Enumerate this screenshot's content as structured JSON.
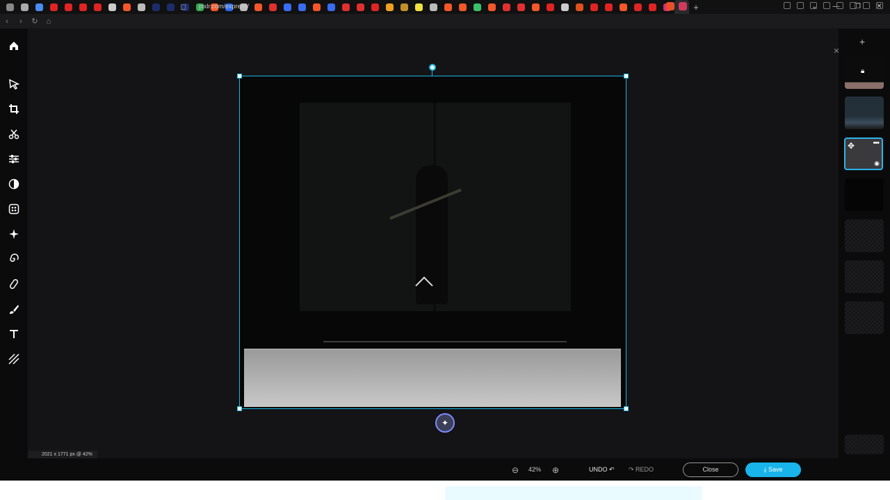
{
  "browser": {
    "tabs": [
      {
        "name": "chrome-icon",
        "color": "#888"
      },
      {
        "name": "settings-icon",
        "color": "#aaa"
      },
      {
        "name": "doc-icon",
        "color": "#4b8cf0"
      },
      {
        "name": "youtube-icon",
        "color": "#e02424"
      },
      {
        "name": "youtube-icon",
        "color": "#e02424"
      },
      {
        "name": "youtube-icon",
        "color": "#e02424"
      },
      {
        "name": "youtube-icon",
        "color": "#e02424"
      },
      {
        "name": "wordpress-icon",
        "color": "#ccc"
      },
      {
        "name": "brave-icon",
        "color": "#f4572a"
      },
      {
        "name": "search-icon",
        "color": "#bbb"
      },
      {
        "name": "us-icon",
        "color": "#1c2d6b"
      },
      {
        "name": "us-icon",
        "color": "#1c2d6b"
      },
      {
        "name": "us-icon",
        "color": "#1c2d6b"
      },
      {
        "name": "chrome-icon",
        "color": "#34a853"
      },
      {
        "name": "brave-icon",
        "color": "#f4572a"
      },
      {
        "name": "site-icon",
        "color": "#2c6df5"
      },
      {
        "name": "search-icon",
        "color": "#bbb"
      },
      {
        "name": "brave-icon",
        "color": "#f4572a"
      },
      {
        "name": "site-icon",
        "color": "#e03030"
      },
      {
        "name": "site-icon",
        "color": "#3a6cf4"
      },
      {
        "name": "site-icon",
        "color": "#3a6cf4"
      },
      {
        "name": "brave-icon",
        "color": "#f4572a"
      },
      {
        "name": "site-icon",
        "color": "#3a6cf4"
      },
      {
        "name": "minus-icon",
        "color": "#e03030"
      },
      {
        "name": "pen-icon",
        "color": "#e03030"
      },
      {
        "name": "youtube-icon",
        "color": "#e02424"
      },
      {
        "name": "site-icon",
        "color": "#f0a020"
      },
      {
        "name": "site-icon",
        "color": "#c0902a"
      },
      {
        "name": "note-icon",
        "color": "#f0e040"
      },
      {
        "name": "game-icon",
        "color": "#bbb"
      },
      {
        "name": "brave-icon",
        "color": "#f4572a"
      },
      {
        "name": "brave-icon",
        "color": "#f4572a"
      },
      {
        "name": "site-icon",
        "color": "#3cc06c"
      },
      {
        "name": "brave-icon",
        "color": "#f4572a"
      },
      {
        "name": "site-icon",
        "color": "#e03030"
      },
      {
        "name": "site-icon",
        "color": "#e03030"
      },
      {
        "name": "brave-icon",
        "color": "#f4572a"
      },
      {
        "name": "youtube-icon",
        "color": "#e02424"
      },
      {
        "name": "speaker-icon",
        "color": "#ccc"
      },
      {
        "name": "site-icon",
        "color": "#e0501c"
      },
      {
        "name": "youtube-icon",
        "color": "#e02424"
      },
      {
        "name": "youtube-icon",
        "color": "#e02424"
      },
      {
        "name": "brave-icon",
        "color": "#f4572a"
      },
      {
        "name": "youtube-icon",
        "color": "#e02424"
      },
      {
        "name": "youtube-icon",
        "color": "#e02424"
      },
      {
        "name": "instagram-icon",
        "color": "#d6306e"
      }
    ],
    "url": "pixlr.com/express/"
  },
  "editor": {
    "tools": [
      "home-icon",
      "arrange-tool-icon",
      "crop-tool-icon",
      "cutout-tool-icon",
      "adjust-tool-icon",
      "filter-tool-icon",
      "effect-tool-icon",
      "retouch-tool-icon",
      "liquify-tool-icon",
      "heal-tool-icon",
      "brush-tool-icon",
      "text-tool-icon",
      "pattern-tool-icon"
    ],
    "status": "2021 x 1771 px @ 42%",
    "zoom": "42%",
    "undo_label": "UNDO",
    "redo_label": "REDO",
    "close_label": "Close",
    "save_label": "Save",
    "accent": "#18b4ea"
  }
}
